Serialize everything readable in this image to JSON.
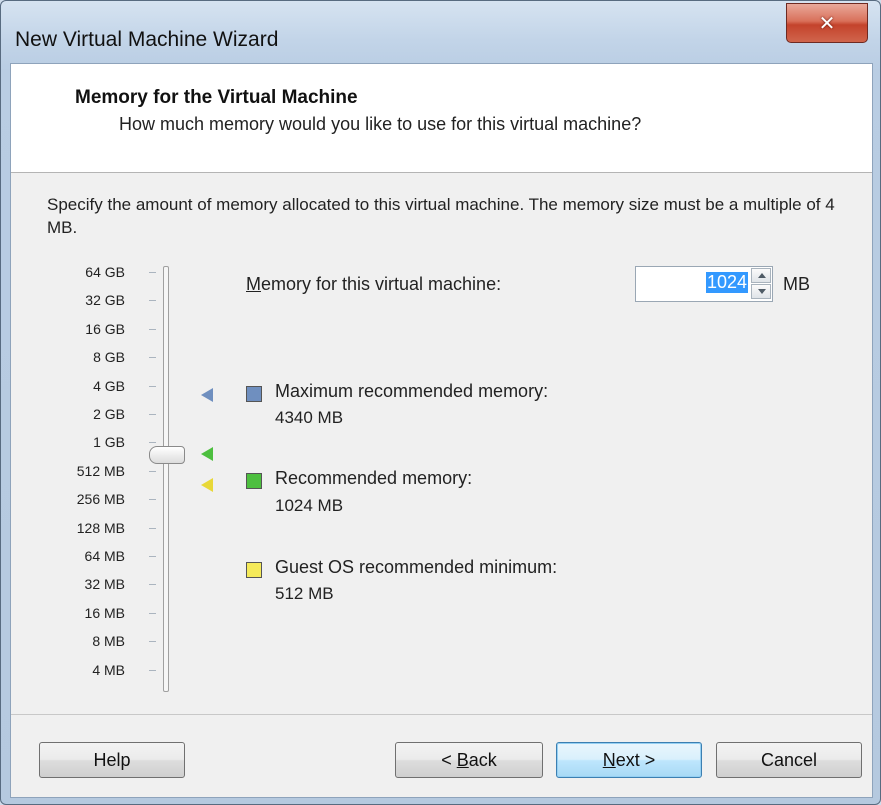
{
  "window": {
    "title": "New Virtual Machine Wizard",
    "close_glyph": "✕"
  },
  "header": {
    "title": "Memory for the Virtual Machine",
    "subtitle": "How much memory would you like to use for this virtual machine?"
  },
  "description": "Specify the amount of memory allocated to this virtual machine. The memory size must be a multiple of 4 MB.",
  "memory": {
    "label_accel": "M",
    "label_rest": "emory for this virtual machine:",
    "value": "1024",
    "unit": "MB"
  },
  "slider": {
    "labels": [
      "64 GB",
      "32 GB",
      "16 GB",
      "8 GB",
      "4 GB",
      "2 GB",
      "1 GB",
      "512 MB",
      "256 MB",
      "128 MB",
      "64 MB",
      "32 MB",
      "16 MB",
      "8 MB",
      "4 MB"
    ],
    "selected": "1 GB"
  },
  "legend": {
    "max": {
      "label": "Maximum recommended memory:",
      "value": "4340 MB",
      "color": "#6f8fbf"
    },
    "recommended": {
      "label": "Recommended memory:",
      "value": "1024 MB",
      "color": "#4dbf3f"
    },
    "minimum": {
      "label": "Guest OS recommended minimum:",
      "value": "512 MB",
      "color": "#f5ea5a"
    }
  },
  "buttons": {
    "help": "Help",
    "back_pre": "< ",
    "back_accel": "B",
    "back_rest": "ack",
    "next_accel": "N",
    "next_rest": "ext >",
    "cancel": "Cancel"
  },
  "colors": {
    "selection": "#3399ff",
    "title_bar": "#c2d4e8",
    "close": "#c4432c"
  }
}
